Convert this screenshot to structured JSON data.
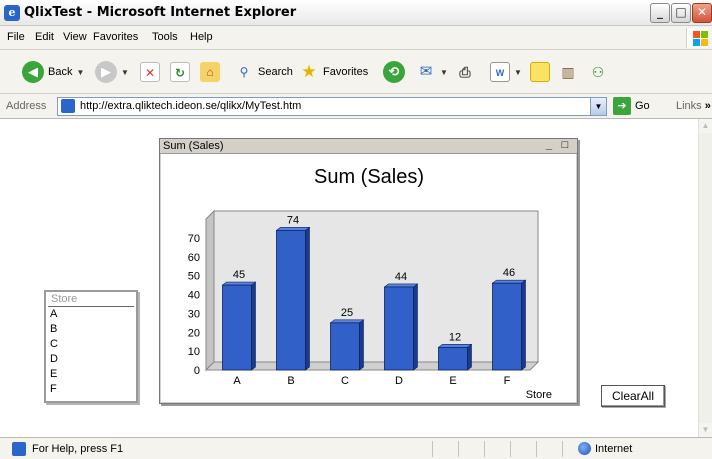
{
  "window": {
    "title": "QlixTest - Microsoft Internet Explorer",
    "controls": {
      "minimize": "_",
      "maximize": "□",
      "close": "✕"
    }
  },
  "menubar": {
    "items": [
      "File",
      "Edit",
      "View",
      "Favorites",
      "Tools",
      "Help"
    ]
  },
  "toolbar": {
    "back_label": "Back",
    "search_label": "Search",
    "favorites_label": "Favorites"
  },
  "address": {
    "label": "Address",
    "url": "http://extra.qliktech.ideon.se/qlikx/MyTest.htm",
    "go_label": "Go",
    "links_label": "Links",
    "links_chevron": "»"
  },
  "chart_object": {
    "caption": "Sum (Sales)",
    "min_glyph": "_",
    "max_glyph": "□"
  },
  "chart_data": {
    "type": "bar",
    "title": "Sum (Sales)",
    "categories": [
      "A",
      "B",
      "C",
      "D",
      "E",
      "F"
    ],
    "values": [
      45,
      74,
      25,
      44,
      12,
      46
    ],
    "xlabel": "Store",
    "ylabel": "",
    "ylim": [
      0,
      80
    ],
    "yticks": [
      0,
      10,
      20,
      30,
      40,
      50,
      60,
      70
    ],
    "bar_color": "#3060c8",
    "background_color": "#e6e6e6",
    "data_labels": true,
    "grid": false,
    "style": "3d"
  },
  "listbox": {
    "header": "Store",
    "items": [
      "A",
      "B",
      "C",
      "D",
      "E",
      "F"
    ]
  },
  "clear_button": {
    "label": "ClearAll"
  },
  "status": {
    "text": "For Help, press F1",
    "zone": "Internet"
  },
  "colors": {
    "accent": "#2a66c8",
    "chart_bar": "#3060c8",
    "window_chrome": "#f4f3ee"
  }
}
